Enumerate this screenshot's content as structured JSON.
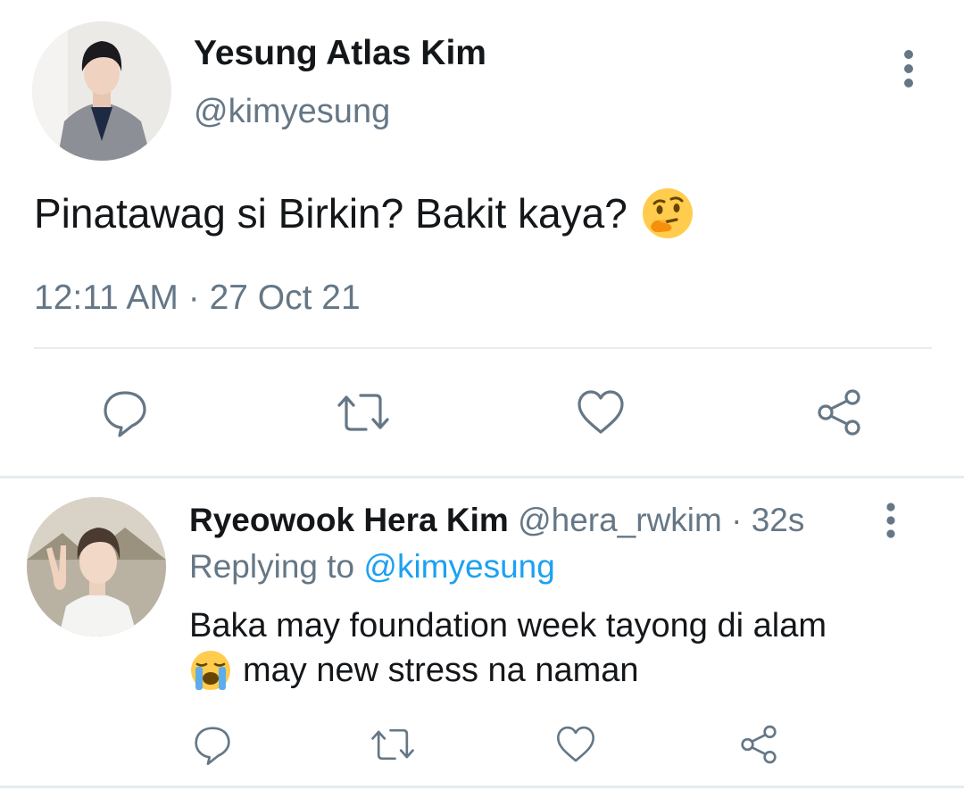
{
  "tweet": {
    "author_name": "Yesung Atlas Kim",
    "author_handle": "@kimyesung",
    "text": "Pinatawag si Birkin? Bakit kaya?",
    "emoji": "thinking-face",
    "time": "12:11 AM",
    "separator": "·",
    "date": "27 Oct 21",
    "actions": [
      "reply",
      "retweet",
      "like",
      "share"
    ]
  },
  "reply": {
    "author_name": "Ryeowook Hera Kim",
    "author_handle": "@hera_rwkim",
    "separator": "·",
    "age": "32s",
    "replying_prefix": "Replying to",
    "replying_handle": "@kimyesung",
    "text_line1": "Baka may foundation week tayong di alam",
    "text_line2": "may new stress na naman",
    "emoji": "loudly-crying-face",
    "actions": [
      "reply",
      "retweet",
      "like",
      "share"
    ]
  },
  "colors": {
    "text": "#14171a",
    "secondary": "#657786",
    "link": "#1da1f2",
    "divider": "#e6ecf0"
  }
}
